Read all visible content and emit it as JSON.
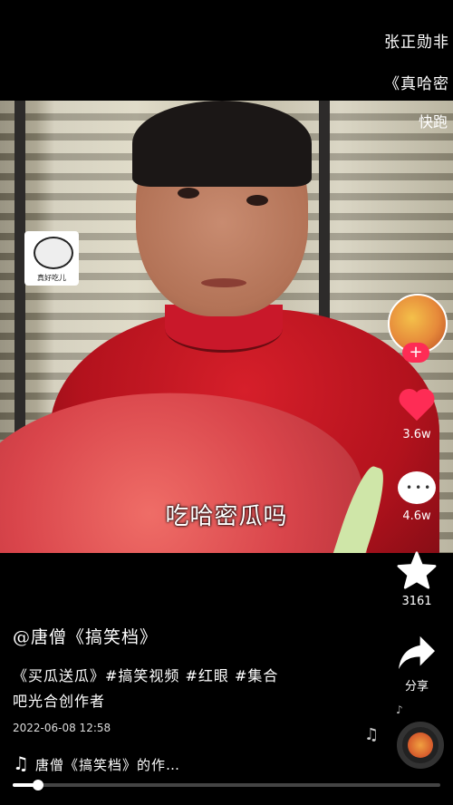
{
  "overlay": {
    "line1": "张正勋非",
    "line2": "《真哈密",
    "line3": "快跑"
  },
  "video": {
    "subtitle": "吃哈密瓜吗",
    "sticker_text": "真好吃儿"
  },
  "actions": {
    "likes": "3.6w",
    "comments": "4.6w",
    "favorites": "3161",
    "share_label": "分享"
  },
  "info": {
    "author": "@唐僧《搞笑档》",
    "description": "《买瓜送瓜》#搞笑视频 #红眼 #集合\n吧光合创作者",
    "date": "2022-06-08 12:58",
    "music": "唐僧《搞笑档》的作…"
  },
  "playback": {
    "progress": 0.06
  },
  "colors": {
    "accent": "#fe2c55",
    "background": "#000000"
  },
  "icons": [
    "plus-icon",
    "heart-icon",
    "comment-icon",
    "star-icon",
    "share-icon",
    "music-note-icon",
    "music-disc-icon"
  ]
}
